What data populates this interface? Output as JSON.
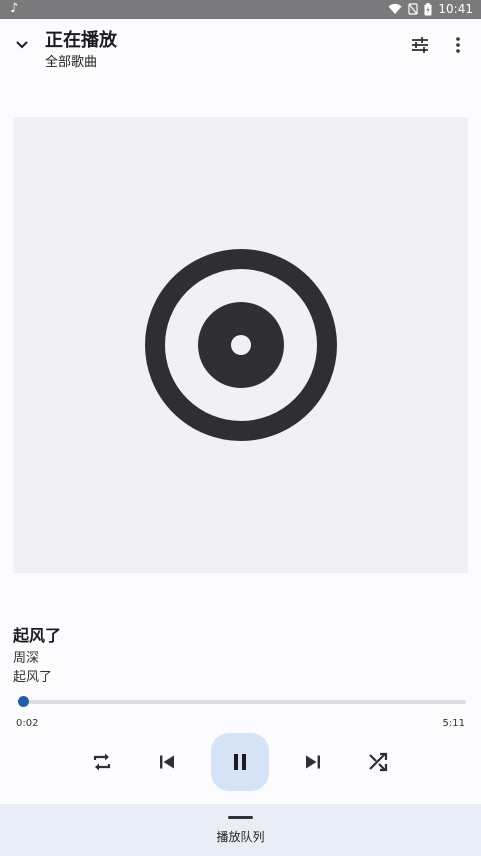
{
  "status_bar": {
    "time": "10:41"
  },
  "header": {
    "title": "正在播放",
    "subtitle": "全部歌曲"
  },
  "track": {
    "title": "起风了",
    "artist": "周深",
    "album": "起风了"
  },
  "playback": {
    "current_time": "0:02",
    "total_time": "5:11",
    "progress_fraction": 0.0064
  },
  "queue": {
    "label": "播放队列"
  },
  "colors": {
    "accent": "#1f5fa8",
    "play_bg": "#d6e3f6",
    "art_bg": "#f1f0f5",
    "disc": "#2e2e33"
  }
}
